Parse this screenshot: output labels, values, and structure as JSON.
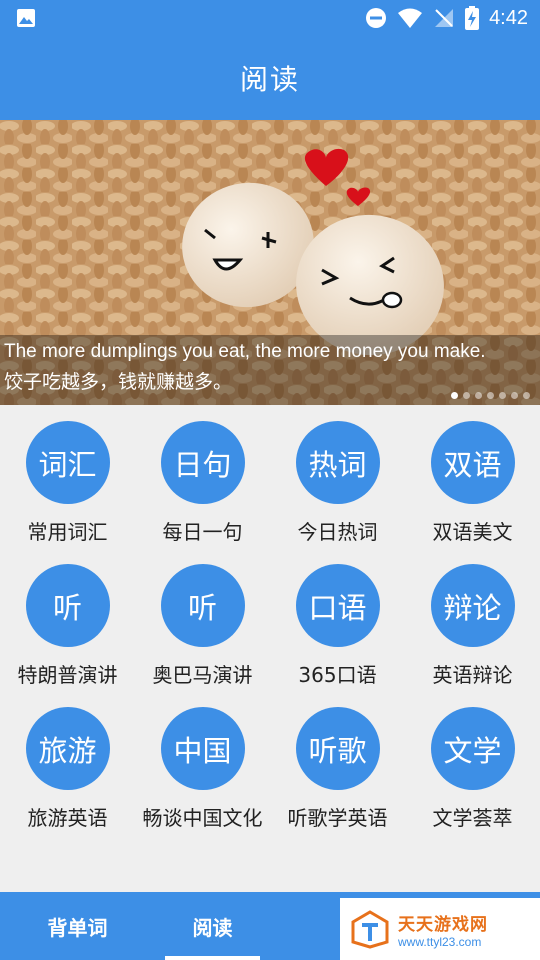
{
  "status_bar": {
    "time": "4:42",
    "icons": [
      "image-icon",
      "do-not-disturb-icon",
      "wifi-icon",
      "no-signal-icon",
      "battery-charging-icon"
    ]
  },
  "app_bar": {
    "title": "阅读"
  },
  "banner": {
    "caption_en": "The more dumplings you eat, the more money you make.",
    "caption_zh": "饺子吃越多，钱就赚越多。",
    "page_count": 7,
    "active_page": 1
  },
  "grid": [
    {
      "icon_text": "词汇",
      "label": "常用词汇"
    },
    {
      "icon_text": "日句",
      "label": "每日一句"
    },
    {
      "icon_text": "热词",
      "label": "今日热词"
    },
    {
      "icon_text": "双语",
      "label": "双语美文"
    },
    {
      "icon_text": "听",
      "label": "特朗普演讲"
    },
    {
      "icon_text": "听",
      "label": "奥巴马演讲"
    },
    {
      "icon_text": "口语",
      "label": "365口语"
    },
    {
      "icon_text": "辩论",
      "label": "英语辩论"
    },
    {
      "icon_text": "旅游",
      "label": "旅游英语"
    },
    {
      "icon_text": "中国",
      "label": "畅谈中国文化"
    },
    {
      "icon_text": "听歌",
      "label": "听歌学英语"
    },
    {
      "icon_text": "文学",
      "label": "文学荟萃"
    }
  ],
  "tabs": [
    {
      "label": "背单词",
      "active": false
    },
    {
      "label": "阅读",
      "active": true
    },
    {
      "label": "",
      "active": false
    }
  ],
  "watermark": {
    "brand": "天天游戏网",
    "url": "www.ttyl23.com"
  },
  "colors": {
    "primary": "#3d8fe6",
    "background": "#efefef",
    "watermark_orange": "#e7711b"
  }
}
